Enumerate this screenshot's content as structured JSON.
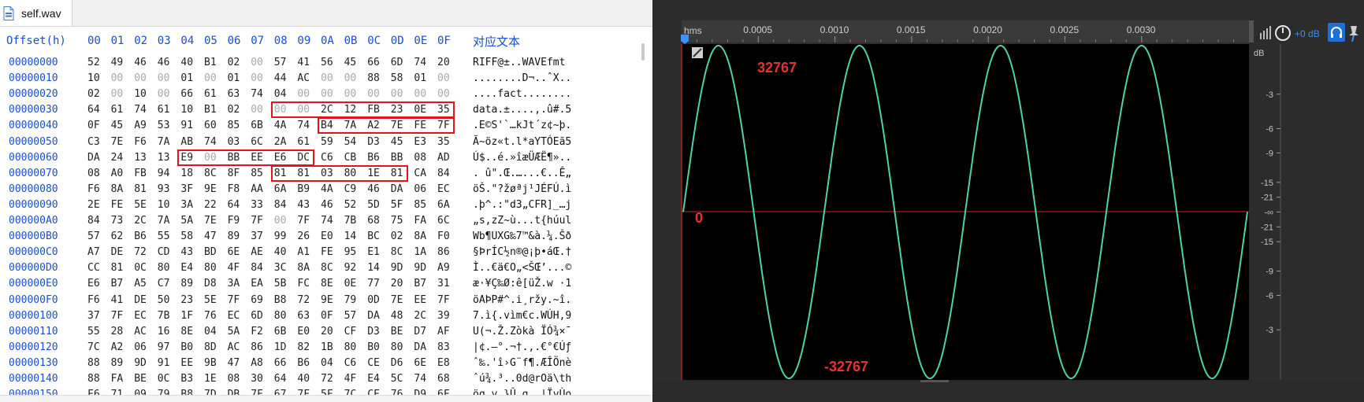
{
  "file_tab": {
    "name": "self.wav",
    "icon": "wav-file-icon"
  },
  "hex_header": {
    "offset_label": "Offset(h)",
    "columns": [
      "00",
      "01",
      "02",
      "03",
      "04",
      "05",
      "06",
      "07",
      "08",
      "09",
      "0A",
      "0B",
      "0C",
      "0D",
      "0E",
      "0F"
    ],
    "text_label": "对应文本"
  },
  "hex_rows": [
    {
      "addr": "00000000",
      "bytes": [
        "52",
        "49",
        "46",
        "46",
        "40",
        "B1",
        "02",
        "00",
        "57",
        "41",
        "56",
        "45",
        "66",
        "6D",
        "74",
        "20"
      ],
      "text": "RIFF@±..WAVEfmt "
    },
    {
      "addr": "00000010",
      "bytes": [
        "10",
        "00",
        "00",
        "00",
        "01",
        "00",
        "01",
        "00",
        "44",
        "AC",
        "00",
        "00",
        "88",
        "58",
        "01",
        "00"
      ],
      "text": "........D¬..ˆX.."
    },
    {
      "addr": "00000020",
      "bytes": [
        "02",
        "00",
        "10",
        "00",
        "66",
        "61",
        "63",
        "74",
        "04",
        "00",
        "00",
        "00",
        "00",
        "00",
        "00",
        "00"
      ],
      "text": "....fact........"
    },
    {
      "addr": "00000030",
      "bytes": [
        "64",
        "61",
        "74",
        "61",
        "10",
        "B1",
        "02",
        "00",
        "00",
        "00",
        "2C",
        "12",
        "FB",
        "23",
        "0E",
        "35"
      ],
      "text": "data.±....,.û#.5"
    },
    {
      "addr": "00000040",
      "bytes": [
        "0F",
        "45",
        "A9",
        "53",
        "91",
        "60",
        "85",
        "6B",
        "4A",
        "74",
        "B4",
        "7A",
        "A2",
        "7E",
        "FE",
        "7F"
      ],
      "text": ".E©S'`…kJt´z¢~þ."
    },
    {
      "addr": "00000050",
      "bytes": [
        "C3",
        "7E",
        "F6",
        "7A",
        "AB",
        "74",
        "03",
        "6C",
        "2A",
        "61",
        "59",
        "54",
        "D3",
        "45",
        "E3",
        "35"
      ],
      "text": "Ã~öz«t.l*aYTÓEã5"
    },
    {
      "addr": "00000060",
      "bytes": [
        "DA",
        "24",
        "13",
        "13",
        "E9",
        "00",
        "BB",
        "EE",
        "E6",
        "DC",
        "C6",
        "CB",
        "B6",
        "BB",
        "08",
        "AD"
      ],
      "text": "Ú$..é.»îæÜÆË¶».."
    },
    {
      "addr": "00000070",
      "bytes": [
        "08",
        "A0",
        "FB",
        "94",
        "18",
        "8C",
        "8F",
        "85",
        "81",
        "81",
        "03",
        "80",
        "1E",
        "81",
        "CA",
        "84"
      ],
      "text": ". û\".Œ.…...€..Ê„"
    },
    {
      "addr": "00000080",
      "bytes": [
        "F6",
        "8A",
        "81",
        "93",
        "3F",
        "9E",
        "F8",
        "AA",
        "6A",
        "B9",
        "4A",
        "C9",
        "46",
        "DA",
        "06",
        "EC"
      ],
      "text": "öŠ.\"?žøªj¹JÉFÚ.ì"
    },
    {
      "addr": "00000090",
      "bytes": [
        "2E",
        "FE",
        "5E",
        "10",
        "3A",
        "22",
        "64",
        "33",
        "84",
        "43",
        "46",
        "52",
        "5D",
        "5F",
        "85",
        "6A"
      ],
      "text": ".þ^.:\"d3„CFR]_…j"
    },
    {
      "addr": "000000A0",
      "bytes": [
        "84",
        "73",
        "2C",
        "7A",
        "5A",
        "7E",
        "F9",
        "7F",
        "00",
        "7F",
        "74",
        "7B",
        "68",
        "75",
        "FA",
        "6C"
      ],
      "text": "„s,zZ~ù...t{húul"
    },
    {
      "addr": "000000B0",
      "bytes": [
        "57",
        "62",
        "B6",
        "55",
        "58",
        "47",
        "89",
        "37",
        "99",
        "26",
        "E0",
        "14",
        "BC",
        "02",
        "8A",
        "F0"
      ],
      "text": "Wb¶UXG‰7™&à.¼.Šð"
    },
    {
      "addr": "000000C0",
      "bytes": [
        "A7",
        "DE",
        "72",
        "CD",
        "43",
        "BD",
        "6E",
        "AE",
        "40",
        "A1",
        "FE",
        "95",
        "E1",
        "8C",
        "1A",
        "86"
      ],
      "text": "§ÞrÍC½n®@¡þ•áŒ.†"
    },
    {
      "addr": "000000D0",
      "bytes": [
        "CC",
        "81",
        "0C",
        "80",
        "E4",
        "80",
        "4F",
        "84",
        "3C",
        "8A",
        "8C",
        "92",
        "14",
        "9D",
        "9D",
        "A9"
      ],
      "text": "Ì..€ä€O„<ŠŒ’...©"
    },
    {
      "addr": "000000E0",
      "bytes": [
        "E6",
        "B7",
        "A5",
        "C7",
        "89",
        "D8",
        "3A",
        "EA",
        "5B",
        "FC",
        "8E",
        "0E",
        "77",
        "20",
        "B7",
        "31"
      ],
      "text": "æ·¥Ç‰Ø:ê[üŽ.w ·1"
    },
    {
      "addr": "000000F0",
      "bytes": [
        "F6",
        "41",
        "DE",
        "50",
        "23",
        "5E",
        "7F",
        "69",
        "B8",
        "72",
        "9E",
        "79",
        "0D",
        "7E",
        "EE",
        "7F"
      ],
      "text": "öAÞP#^.i¸ržy.~î."
    },
    {
      "addr": "00000100",
      "bytes": [
        "37",
        "7F",
        "EC",
        "7B",
        "1F",
        "76",
        "EC",
        "6D",
        "80",
        "63",
        "0F",
        "57",
        "DA",
        "48",
        "2C",
        "39"
      ],
      "text": "7.ì{.vìm€c.WÚH,9"
    },
    {
      "addr": "00000110",
      "bytes": [
        "55",
        "28",
        "AC",
        "16",
        "8E",
        "04",
        "5A",
        "F2",
        "6B",
        "E0",
        "20",
        "CF",
        "D3",
        "BE",
        "D7",
        "AF"
      ],
      "text": "U(¬.Ž.Zòkà ÏÓ¾×¯"
    },
    {
      "addr": "00000120",
      "bytes": [
        "7C",
        "A2",
        "06",
        "97",
        "B0",
        "8D",
        "AC",
        "86",
        "1D",
        "82",
        "1B",
        "80",
        "B0",
        "80",
        "DA",
        "83"
      ],
      "text": "|¢.—°.¬†.‚.€°€Úƒ"
    },
    {
      "addr": "00000130",
      "bytes": [
        "88",
        "89",
        "9D",
        "91",
        "EE",
        "9B",
        "47",
        "A8",
        "66",
        "B6",
        "04",
        "C6",
        "CE",
        "D6",
        "6E",
        "E8"
      ],
      "text": "ˆ‰.'î›G¨f¶.ÆÎÖnè"
    },
    {
      "addr": "00000140",
      "bytes": [
        "88",
        "FA",
        "BE",
        "0C",
        "B3",
        "1E",
        "08",
        "30",
        "64",
        "40",
        "72",
        "4F",
        "E4",
        "5C",
        "74",
        "68"
      ],
      "text": "ˆú¾.³..0d@rOä\\th"
    },
    {
      "addr": "00000150",
      "bytes": [
        "F6",
        "71",
        "09",
        "79",
        "B8",
        "7D",
        "DB",
        "7F",
        "67",
        "7F",
        "5F",
        "7C",
        "CF",
        "76",
        "D9",
        "6F"
      ],
      "text": "öq.y¸}Û.g._|ÏvÙo"
    }
  ],
  "wave": {
    "ruler_unit": "hms",
    "ruler_ticks": [
      "0.0005",
      "0.0010",
      "0.0015",
      "0.0020",
      "0.0025",
      "0.0030"
    ],
    "db_unit": "dB",
    "db_ticks_top": [
      "-3",
      "-6",
      "-9",
      "-15",
      "-21"
    ],
    "db_center": "-∞",
    "db_ticks_bottom": [
      "-21",
      "-15",
      "-9",
      "-6",
      "-3"
    ],
    "amp_max_label": "32767",
    "amp_zero_label": "0",
    "amp_min_label": "-32767",
    "level_label": "+0 dB",
    "colors": {
      "wave": "#4ed3a8",
      "center_line": "#c8252c",
      "annotation": "#e53333",
      "background": "#000000"
    },
    "waveform": {
      "cycles": 4,
      "time_span_s": 0.0037
    }
  }
}
